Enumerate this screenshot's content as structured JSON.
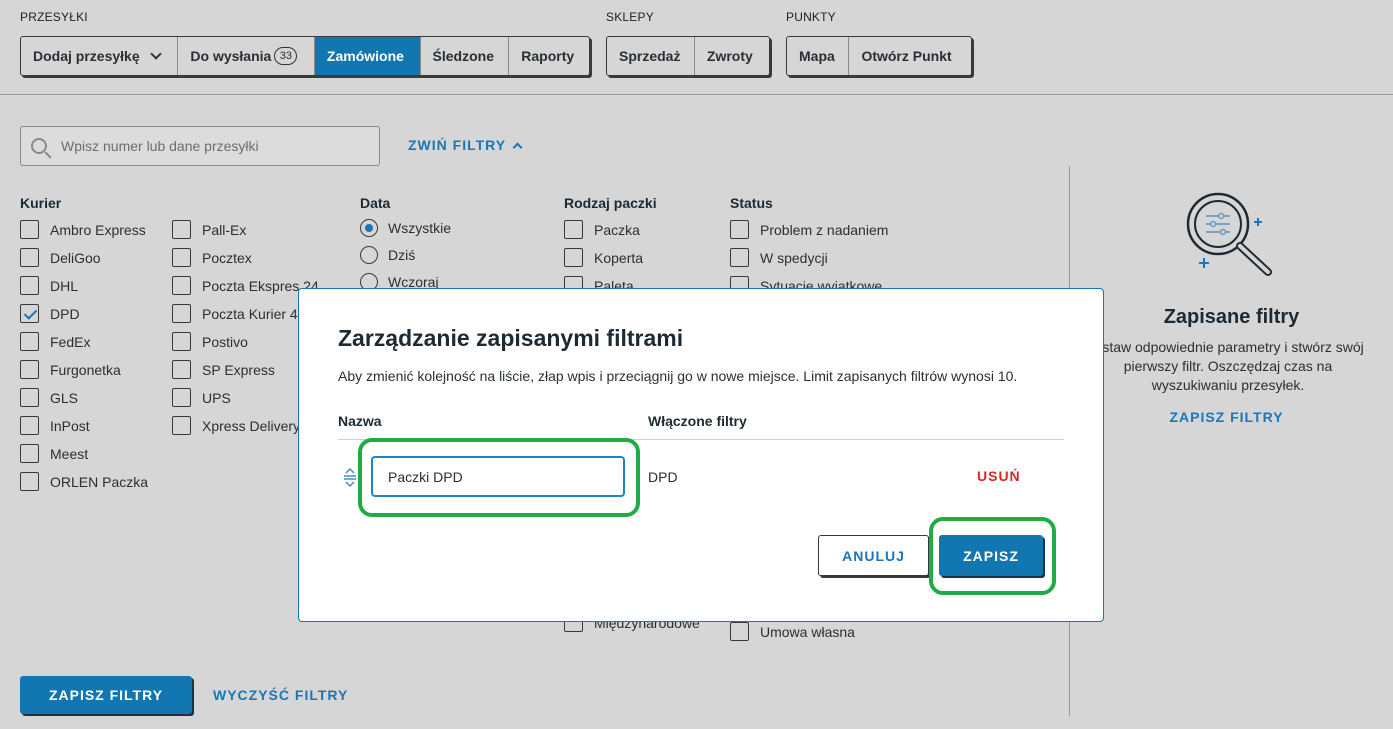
{
  "nav": {
    "shipments_label": "PRZESYŁKI",
    "shops_label": "SKLEPY",
    "points_label": "PUNKTY",
    "add_shipment": "Dodaj przesyłkę",
    "to_send": "Do wysłania",
    "to_send_count": "33",
    "orders": "Zamówione",
    "tracked": "Śledzone",
    "reports": "Raporty",
    "sales": "Sprzedaż",
    "returns": "Zwroty",
    "map": "Mapa",
    "open_point": "Otwórz Punkt"
  },
  "search": {
    "placeholder": "Wpisz numer lub dane przesyłki"
  },
  "collapse_filters": "ZWIŃ FILTRY",
  "filters": {
    "courier_title": "Kurier",
    "couriers_col1": [
      {
        "label": "Ambro Express",
        "checked": false
      },
      {
        "label": "DeliGoo",
        "checked": false
      },
      {
        "label": "DHL",
        "checked": false
      },
      {
        "label": "DPD",
        "checked": true
      },
      {
        "label": "FedEx",
        "checked": false
      },
      {
        "label": "Furgonetka",
        "checked": false
      },
      {
        "label": "GLS",
        "checked": false
      },
      {
        "label": "InPost",
        "checked": false
      },
      {
        "label": "Meest",
        "checked": false
      },
      {
        "label": "ORLEN Paczka",
        "checked": false
      }
    ],
    "couriers_col2": [
      {
        "label": "Pall-Ex",
        "checked": false
      },
      {
        "label": "Pocztex",
        "checked": false
      },
      {
        "label": "Poczta Ekspres 24",
        "checked": false
      },
      {
        "label": "Poczta Kurier 4",
        "checked": false
      },
      {
        "label": "Postivo",
        "checked": false
      },
      {
        "label": "SP Express",
        "checked": false
      },
      {
        "label": "UPS",
        "checked": false
      },
      {
        "label": "Xpress Delivery",
        "checked": false
      }
    ],
    "date_title": "Data",
    "dates": [
      {
        "label": "Wszystkie",
        "checked": true
      },
      {
        "label": "Dziś",
        "checked": false
      },
      {
        "label": "Wczoraj",
        "checked": false
      }
    ],
    "package_title": "Rodzaj paczki",
    "packages": [
      "Paczka",
      "Koperta",
      "Paleta"
    ],
    "package_bottom": "Międzynarodowe",
    "status_title": "Status",
    "statuses": [
      "Problem z nadaniem",
      "W spedycji",
      "Sytuacje wyjątkowe"
    ],
    "status_bottom": "Umowa własna"
  },
  "saved": {
    "title": "Zapisane filtry",
    "description": "Ustaw odpowiednie parametry i stwórz swój pierwszy filtr. Oszczędzaj czas na wyszukiwaniu przesyłek.",
    "link": "ZAPISZ FILTRY"
  },
  "footer": {
    "save_filters": "ZAPISZ FILTRY",
    "clear_filters": "WYCZYŚĆ FILTRY"
  },
  "modal": {
    "title": "Zarządzanie zapisanymi filtrami",
    "subtitle": "Aby zmienić kolejność na liście, złap wpis i przeciągnij go w nowe miejsce. Limit zapisanych filtrów wynosi 10.",
    "col_name": "Nazwa",
    "col_filters": "Włączone filtry",
    "row_name": "Paczki DPD",
    "row_filters": "DPD",
    "delete": "USUŃ",
    "cancel": "ANULUJ",
    "save": "ZAPISZ"
  },
  "colors": {
    "accent": "#1276b0",
    "danger": "#d62828",
    "highlight": "#22aa44"
  }
}
